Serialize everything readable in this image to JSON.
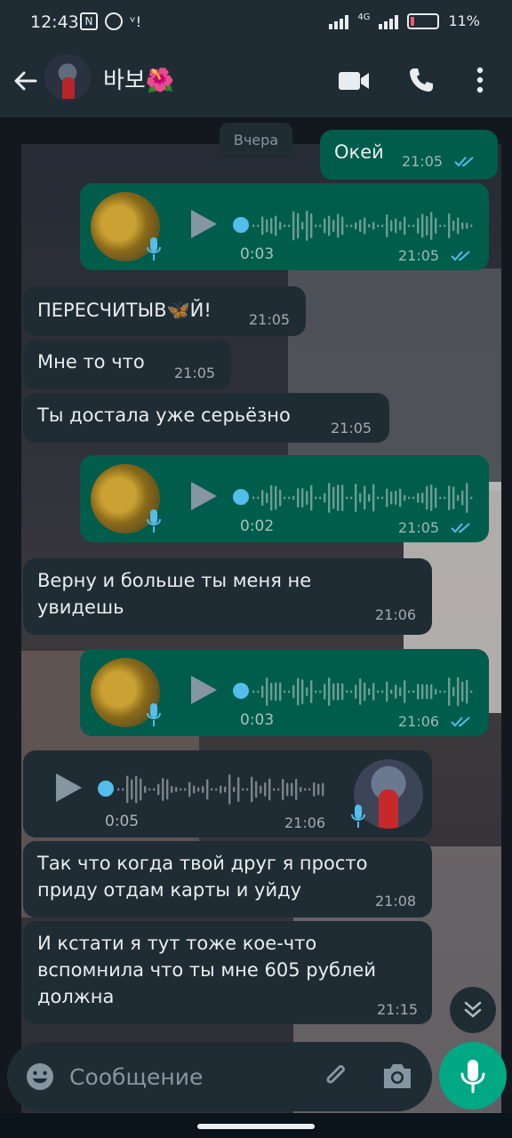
{
  "status_bar": {
    "time": "12:43",
    "network": "4G",
    "battery": "11%",
    "icons": [
      "nfc-icon",
      "whatsapp-icon",
      "wifi-call-icon",
      "signal-icon",
      "battery-icon"
    ]
  },
  "header": {
    "contact_name": "바보🌺",
    "icons": [
      "back-arrow-icon",
      "video-call-icon",
      "phone-icon",
      "more-icon"
    ]
  },
  "chat": {
    "date_chip": "Вчера",
    "messages": [
      {
        "dir": "out",
        "type": "text",
        "text": "Окей",
        "time": "21:05",
        "read": true
      },
      {
        "dir": "out",
        "type": "voice",
        "duration": "0:03",
        "time": "21:05",
        "read": true
      },
      {
        "dir": "in",
        "type": "text",
        "text": "ПЕРЕСЧИТЫВ🦋Й!",
        "time": "21:05"
      },
      {
        "dir": "in",
        "type": "text",
        "text": "Мне то что",
        "time": "21:05"
      },
      {
        "dir": "in",
        "type": "text",
        "text": "Ты достала уже серьёзно",
        "time": "21:05"
      },
      {
        "dir": "out",
        "type": "voice",
        "duration": "0:02",
        "time": "21:05",
        "read": true
      },
      {
        "dir": "in",
        "type": "text",
        "text": "Верну и больше ты меня не увидешь",
        "time": "21:06"
      },
      {
        "dir": "out",
        "type": "voice",
        "duration": "0:03",
        "time": "21:06",
        "read": true
      },
      {
        "dir": "in",
        "type": "voice",
        "duration": "0:05",
        "time": "21:06"
      },
      {
        "dir": "in",
        "type": "text",
        "text": "Так что когда твой друг я просто приду отдам карты и уйду",
        "time": "21:08"
      },
      {
        "dir": "in",
        "type": "text",
        "text": "И кстати я тут тоже кое-что вспомнила что ты мне 605 рублей должна",
        "time": "21:15"
      }
    ]
  },
  "composer": {
    "placeholder": "Сообщение",
    "icons": [
      "emoji-icon",
      "attach-icon",
      "camera-icon",
      "mic-icon"
    ]
  },
  "colors": {
    "outgoing_bubble": "#005c4b",
    "incoming_bubble": "#1f2c34",
    "read_ticks": "#53bdeb",
    "send_button": "#00a884"
  }
}
